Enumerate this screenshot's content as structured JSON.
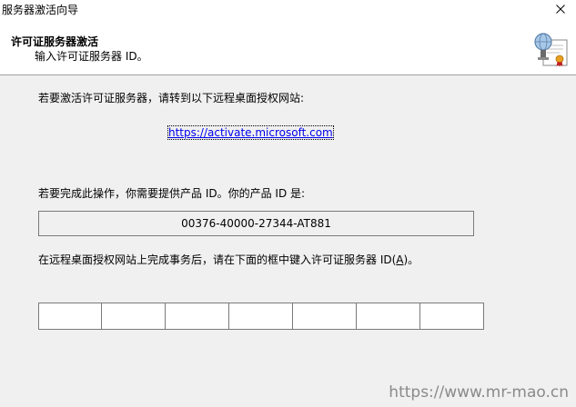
{
  "window": {
    "title": "服务器激活向导"
  },
  "header": {
    "title": "许可证服务器激活",
    "subtitle": "输入许可证服务器 ID。"
  },
  "body": {
    "instruction_visit": "若要激活许可证服务器，请转到以下远程桌面授权网站:",
    "activation_link": "https://activate.microsoft.com",
    "instruction_product_id": "若要完成此操作，你需要提供产品 ID。你的产品 ID 是:",
    "product_id": "00376-40000-27344-AT881",
    "instruction_enter_prefix": "在远程桌面授权网站上完成事务后，请在下面的框中键入许可证服务器 ID(",
    "instruction_enter_accesskey": "A",
    "instruction_enter_suffix": ")。",
    "id_fields": [
      "",
      "",
      "",
      "",
      "",
      "",
      ""
    ]
  },
  "watermark": {
    "text": "https://www.mr-mao.cn"
  },
  "colors": {
    "body_background": "#f0f0f0",
    "header_background": "#ffffff",
    "link": "#0000ee",
    "border": "#7a7a7a",
    "watermark": "#8a8a8a"
  },
  "icons": {
    "close": "close-icon",
    "wizard": "certificate-server-icon"
  }
}
